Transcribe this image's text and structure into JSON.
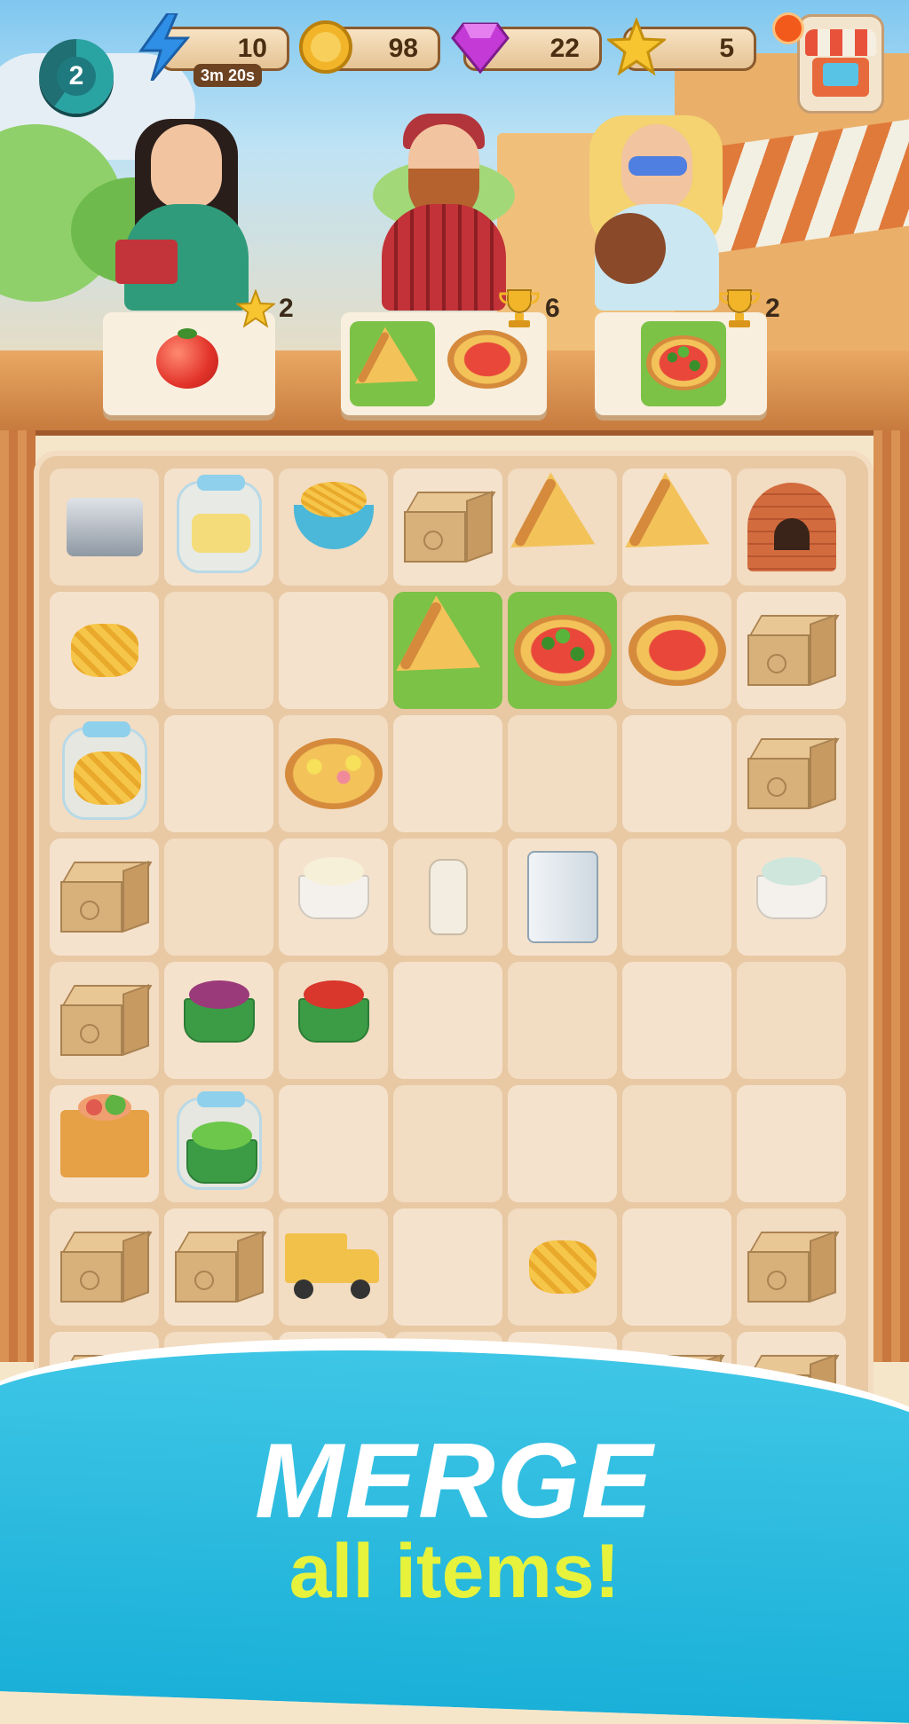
{
  "hud": {
    "level": "2",
    "energy": "10",
    "energy_timer": "3m 20s",
    "coins": "98",
    "gems": "22",
    "stars": "5"
  },
  "orders": [
    {
      "reward": "2",
      "reward_icon": "star-icon",
      "items": [
        "tomato"
      ]
    },
    {
      "reward": "6",
      "reward_icon": "trophy-icon",
      "items": [
        "pizza-slice",
        "pizza"
      ]
    },
    {
      "reward": "2",
      "reward_icon": "trophy-icon",
      "items": [
        "green-pizza"
      ]
    }
  ],
  "board": {
    "rows": [
      [
        "pasta-machine",
        "butter-jar",
        "pasta-bowl",
        "box",
        "pizza-slice",
        "pizza-slice",
        "brick-oven"
      ],
      [
        "tagliatelle",
        "",
        "",
        "pizza-slice",
        "green-pizza",
        "pizza",
        "box"
      ],
      [
        "tagliatelle-jar",
        "",
        "hawaiian-pizza",
        "",
        "",
        "",
        "box"
      ],
      [
        "box",
        "",
        "mozzarella-ramekin",
        "milk-bottle",
        "fridge",
        "",
        "cheese-ramekin"
      ],
      [
        "box",
        "onion-ramekin",
        "tomato-ramekin",
        "",
        "",
        "",
        ""
      ],
      [
        "veggie-box",
        "basil-jar",
        "",
        "",
        "",
        "",
        ""
      ],
      [
        "box",
        "box",
        "delivery-truck",
        "",
        "tagliatelle",
        "",
        "box"
      ],
      [
        "box",
        "box",
        "",
        "",
        "box",
        "box",
        "box"
      ]
    ],
    "highlighted": [
      "1-3",
      "1-4"
    ]
  },
  "banner": {
    "title": "MERGE",
    "subtitle": "all items!"
  },
  "colors": {
    "energy": "#2f8fe6",
    "coin": "#f2b52a",
    "gem": "#c43ad6",
    "star": "#f7c530",
    "highlight": "#7cc246",
    "banner": "#1ab0d8",
    "subtitle": "#e6f23c"
  }
}
